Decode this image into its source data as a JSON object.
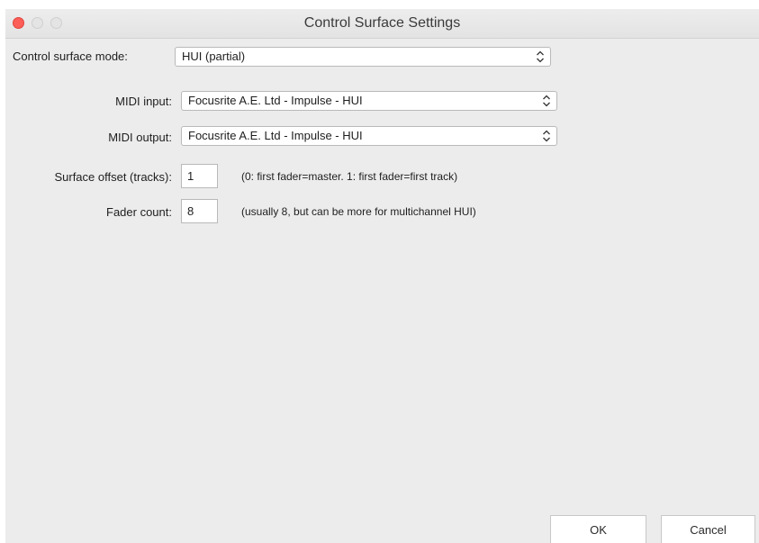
{
  "window": {
    "title": "Control Surface Settings"
  },
  "form": {
    "mode": {
      "label": "Control surface mode:",
      "value": "HUI (partial)"
    },
    "midi_input": {
      "label": "MIDI input:",
      "value": "Focusrite A.E. Ltd - Impulse - HUI"
    },
    "midi_output": {
      "label": "MIDI output:",
      "value": "Focusrite A.E. Ltd - Impulse - HUI"
    },
    "surface_offset": {
      "label": "Surface offset (tracks):",
      "value": "1",
      "hint": "(0: first fader=master. 1: first fader=first track)"
    },
    "fader_count": {
      "label": "Fader count:",
      "value": "8",
      "hint": "(usually 8, but can be more for multichannel HUI)"
    }
  },
  "buttons": {
    "ok": "OK",
    "cancel": "Cancel"
  },
  "icons": {
    "close": "close-button-icon",
    "minimize": "minimize-button-icon",
    "maximize": "zoom-button-icon",
    "chevron": "up-down-chevron-icon"
  },
  "colors": {
    "close": "#fd5e58",
    "window_bg": "#ececec",
    "field_bg": "#ffffff"
  }
}
